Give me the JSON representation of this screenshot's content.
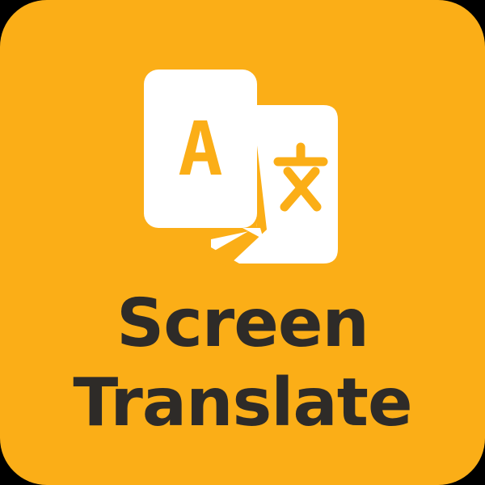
{
  "app": {
    "title_line_1": "Screen",
    "title_line_2": "Translate"
  },
  "logo": {
    "source_glyph": "A",
    "target_glyph": "文"
  },
  "colors": {
    "background": "#FBAE17",
    "card": "#FFFFFF",
    "glyph": "#FBAE17",
    "text": "#2E2B28",
    "outer": "#000000"
  },
  "icons": {
    "logo": "translate-cards-icon"
  }
}
